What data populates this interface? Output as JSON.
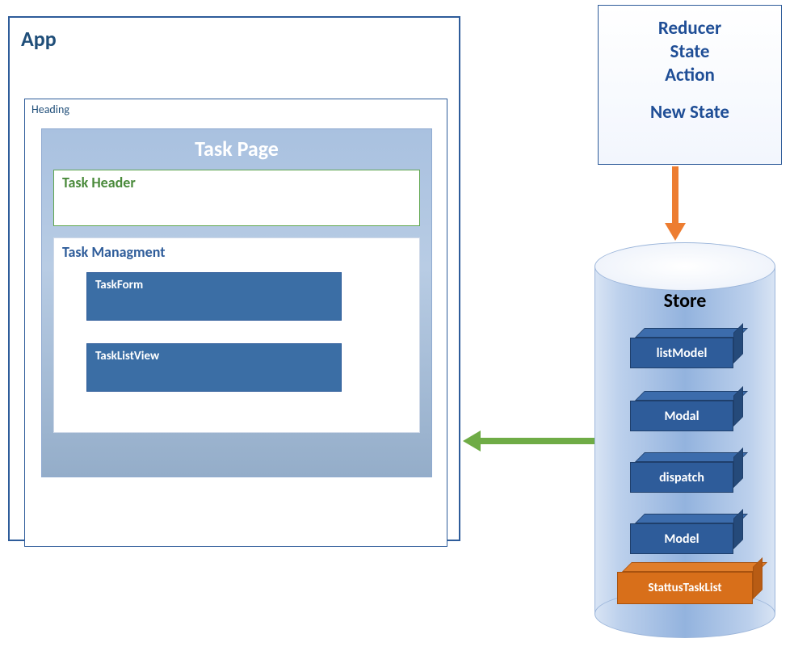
{
  "app": {
    "title": "App",
    "heading_label": "Heading",
    "task_page": {
      "title": "Task Page",
      "task_header": "Task Header",
      "task_management": {
        "title": "Task Managment",
        "task_form": "TaskForm",
        "task_list_view": "TaskListView"
      }
    }
  },
  "reducer": {
    "line1": "Reducer",
    "line2": "State",
    "line3": "Action",
    "new_state": "New State"
  },
  "store": {
    "title": "Store",
    "cubes": {
      "list_model": "listModel",
      "modal": "Modal",
      "dispatch": "dispatch",
      "model": "Model",
      "status_task_list": "StattusTaskList"
    }
  }
}
